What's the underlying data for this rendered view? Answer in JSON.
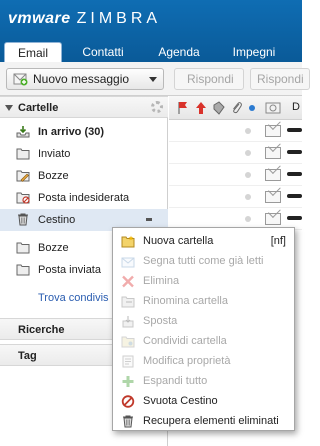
{
  "header": {
    "logo_vm": "vmware",
    "logo_zimbra": "ZIMBRA",
    "tabs": [
      {
        "label": "Email",
        "active": true
      },
      {
        "label": "Contatti"
      },
      {
        "label": "Agenda"
      },
      {
        "label": "Impegni"
      }
    ]
  },
  "toolbar": {
    "new_message": "Nuovo messaggio",
    "reply": "Rispondi",
    "reply_all": "Rispondi"
  },
  "folders": {
    "title": "Cartelle",
    "items": [
      {
        "label": "In arrivo (30)",
        "icon": "inbox-icon",
        "bold": true
      },
      {
        "label": "Inviato",
        "icon": "folder-icon"
      },
      {
        "label": "Bozze",
        "icon": "drafts-icon"
      },
      {
        "label": "Posta indesiderata",
        "icon": "junk-icon"
      },
      {
        "label": "Cestino",
        "icon": "trash-icon",
        "selected": true
      },
      {
        "label": "Bozze",
        "icon": "folder-icon"
      },
      {
        "label": "Posta inviata",
        "icon": "folder-icon"
      }
    ],
    "find_shares": "Trova condivis"
  },
  "sections": {
    "searches": "Ricerche",
    "tags": "Tag"
  },
  "message_list": {
    "col_d": "D"
  },
  "context_menu": {
    "items": [
      {
        "label": "Nuova cartella",
        "shortcut": "[nf]",
        "enabled": true,
        "icon": "new-folder-icon"
      },
      {
        "label": "Segna tutti come già letti",
        "enabled": false,
        "icon": "mark-read-icon"
      },
      {
        "label": "Elimina",
        "enabled": false,
        "icon": "delete-x-icon"
      },
      {
        "label": "Rinomina cartella",
        "enabled": false,
        "icon": "rename-folder-icon"
      },
      {
        "label": "Sposta",
        "enabled": false,
        "icon": "move-icon"
      },
      {
        "label": "Condividi cartella",
        "enabled": false,
        "icon": "share-folder-icon"
      },
      {
        "label": "Modifica proprietà",
        "enabled": false,
        "icon": "edit-properties-icon"
      },
      {
        "label": "Espandi tutto",
        "enabled": false,
        "icon": "expand-all-icon"
      },
      {
        "label": "Svuota Cestino",
        "enabled": true,
        "icon": "empty-trash-icon"
      },
      {
        "label": "Recupera elementi eliminati",
        "enabled": true,
        "icon": "recover-deleted-icon"
      }
    ]
  },
  "colors": {
    "header_blue": "#0f6db3",
    "selected_row": "#dfe8f3",
    "link": "#2a5db0"
  }
}
